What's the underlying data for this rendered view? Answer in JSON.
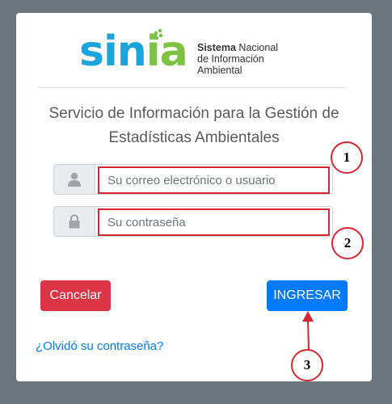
{
  "logo": {
    "word_part1": "sin",
    "word_part2": "ia",
    "line1_bold": "Sistema",
    "line1_rest": " Nacional",
    "line2": "de Información",
    "line3": "Ambiental",
    "colors": {
      "blue": "#1aa4dc",
      "green": "#7dc243"
    }
  },
  "form": {
    "title_line1": "Servicio de Información para la Gestión de",
    "title_line2": "Estadísticas Ambientales",
    "username": {
      "placeholder": "Su correo electrónico o usuario",
      "value": "",
      "icon": "user-icon"
    },
    "password": {
      "placeholder": "Su contraseña",
      "value": "",
      "icon": "lock-icon"
    },
    "cancel_label": "Cancelar",
    "submit_label": "INGRESAR",
    "forgot_label": "¿Olvidó su contraseña?"
  },
  "annotations": {
    "marker1": "1",
    "marker2": "2",
    "marker3": "3"
  },
  "colors": {
    "backdrop": "#6c757d",
    "primary": "#007bff",
    "danger": "#dc3545",
    "annotation_red": "#d62631"
  }
}
